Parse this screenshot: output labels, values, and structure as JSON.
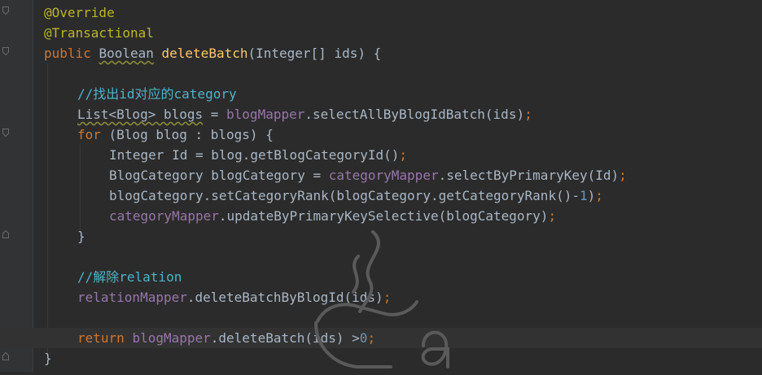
{
  "editor": {
    "lines": [
      {
        "id": "l1",
        "tokens": [
          {
            "t": "@Override",
            "c": "ann"
          }
        ]
      },
      {
        "id": "l2",
        "tokens": [
          {
            "t": "@Transactional",
            "c": "ann"
          }
        ]
      },
      {
        "id": "l3",
        "tokens": [
          {
            "t": "public ",
            "c": "kw"
          },
          {
            "t": "Boolean",
            "c": "type-u"
          },
          {
            "t": " "
          },
          {
            "t": "deleteBatch",
            "c": "meth"
          },
          {
            "t": "(Integer[] ids) {"
          }
        ]
      },
      {
        "id": "l4",
        "tokens": []
      },
      {
        "id": "l5",
        "tokens": [
          {
            "t": "//找出id对应的category",
            "c": "cmt"
          }
        ]
      },
      {
        "id": "l6",
        "tokens": [
          {
            "t": "List<Blog> blogs",
            "c": "warn"
          },
          {
            "t": " = "
          },
          {
            "t": "blogMapper",
            "c": "field"
          },
          {
            "t": ".selectAllByBlogIdBatch(ids)"
          },
          {
            "t": ";",
            "c": "kw"
          }
        ]
      },
      {
        "id": "l7",
        "tokens": [
          {
            "t": "for ",
            "c": "kw"
          },
          {
            "t": "(Blog blog : blogs) {"
          }
        ]
      },
      {
        "id": "l8",
        "tokens": [
          {
            "t": "Integer Id = blog.getBlogCategoryId()"
          },
          {
            "t": ";",
            "c": "kw"
          }
        ]
      },
      {
        "id": "l9",
        "tokens": [
          {
            "t": "BlogCategory blogCategory = "
          },
          {
            "t": "categoryMapper",
            "c": "field"
          },
          {
            "t": ".selectByPrimaryKey(Id)"
          },
          {
            "t": ";",
            "c": "kw"
          }
        ]
      },
      {
        "id": "l10",
        "tokens": [
          {
            "t": "blogCategory.setCategoryRank(blogCategory.getCategoryRank()-"
          },
          {
            "t": "1",
            "c": "num"
          },
          {
            "t": ")"
          },
          {
            "t": ";",
            "c": "kw"
          }
        ]
      },
      {
        "id": "l11",
        "tokens": [
          {
            "t": "categoryMapper",
            "c": "field"
          },
          {
            "t": ".updateByPrimaryKeySelective(blogCategory)"
          },
          {
            "t": ";",
            "c": "kw"
          }
        ]
      },
      {
        "id": "l12",
        "tokens": [
          {
            "t": "}"
          }
        ]
      },
      {
        "id": "l13",
        "tokens": []
      },
      {
        "id": "l14",
        "tokens": [
          {
            "t": "//解除relation",
            "c": "cmt"
          }
        ]
      },
      {
        "id": "l15",
        "tokens": [
          {
            "t": "relationMapper",
            "c": "field"
          },
          {
            "t": ".deleteBatchByBlogId(ids)"
          },
          {
            "t": ";",
            "c": "kw"
          }
        ]
      },
      {
        "id": "l16",
        "tokens": []
      },
      {
        "id": "l17",
        "tokens": [
          {
            "t": "return ",
            "c": "kw"
          },
          {
            "t": "blogMapper",
            "c": "field"
          },
          {
            "t": ".deleteBatch(ids) >"
          },
          {
            "t": "0",
            "c": "num"
          },
          {
            "t": ";",
            "c": "kw"
          }
        ]
      },
      {
        "id": "l18",
        "tokens": [
          {
            "t": "}"
          }
        ]
      }
    ]
  },
  "watermark": {
    "icon": "java-cup-icon"
  },
  "colors": {
    "background": "#2b2b2b",
    "keyword": "#cc7832",
    "annotation": "#bbb529",
    "method": "#ffc66d",
    "field": "#9876aa",
    "comment": "#4fb3c9",
    "number": "#6897bb",
    "text": "#a9b7c6"
  }
}
